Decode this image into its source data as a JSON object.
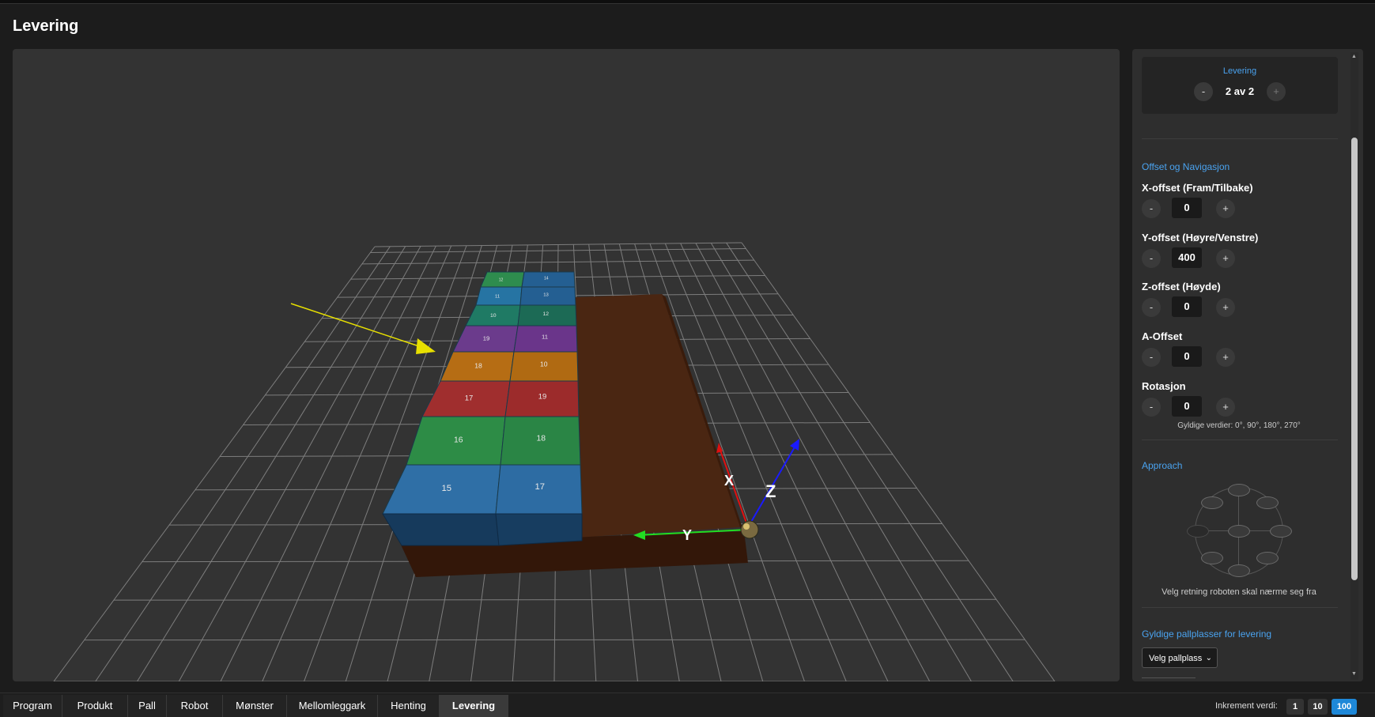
{
  "page": {
    "title": "Levering"
  },
  "viewport": {
    "box_labels": [
      "15",
      "17",
      "16",
      "18",
      "17",
      "19",
      "18",
      "10",
      "19",
      "11",
      "10",
      "12",
      "11",
      "13",
      "12",
      "14"
    ],
    "axes": {
      "x": "X",
      "y": "Y",
      "z": "Z"
    },
    "colors": {
      "background": "#333333",
      "pallet_top": "#4a2612",
      "pallet_side": "#331709"
    }
  },
  "sidebar": {
    "levering": {
      "title": "Levering",
      "value": "2 av 2",
      "minus": "-",
      "plus": "+"
    },
    "offset": {
      "title": "Offset og Navigasjon",
      "fields": [
        {
          "label": "X-offset (Fram/Tilbake)",
          "value": "0",
          "minus": "-",
          "plus": "+"
        },
        {
          "label": "Y-offset (Høyre/Venstre)",
          "value": "400",
          "minus": "-",
          "plus": "+"
        },
        {
          "label": "Z-offset (Høyde)",
          "value": "0",
          "minus": "-",
          "plus": "+"
        },
        {
          "label": "A-Offset",
          "value": "0",
          "minus": "-",
          "plus": "+"
        },
        {
          "label": "Rotasjon",
          "value": "0",
          "minus": "-",
          "plus": "+"
        }
      ],
      "rotation_hint": "Gyldige verdier: 0°, 90°, 180°, 270°"
    },
    "approach": {
      "title": "Approach",
      "hint": "Velg retning roboten skal nærme seg fra"
    },
    "pallplass": {
      "title": "Gyldige pallplasser for levering",
      "select_value": "Velg pallplass",
      "chevron": "⌄"
    }
  },
  "tabs": [
    "Program",
    "Produkt",
    "Pall",
    "Robot",
    "Mønster",
    "Mellomleggark",
    "Henting",
    "Levering"
  ],
  "active_tab": "Levering",
  "increment": {
    "label": "Inkrement verdi:",
    "options": [
      "1",
      "10",
      "100"
    ],
    "active": "100"
  },
  "colors": {
    "accent": "#4aa3f0",
    "active_increment": "#1e88d8"
  }
}
